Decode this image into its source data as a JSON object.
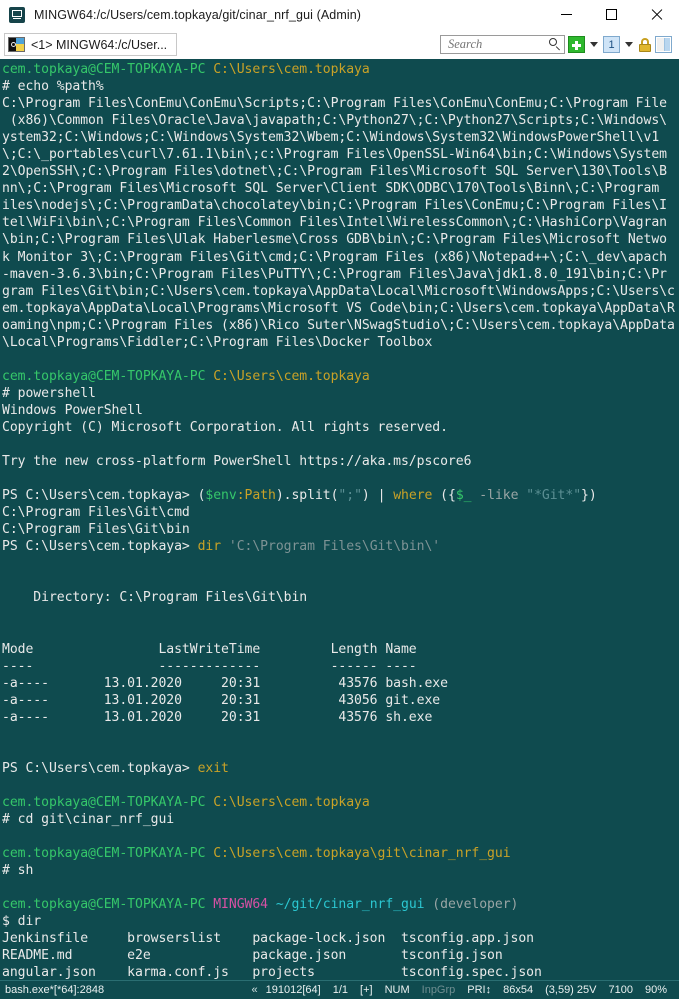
{
  "window": {
    "title": "MINGW64:/c/Users/cem.topkaya/git/cinar_nrf_gui (Admin)",
    "icon": "conemu-icon",
    "minimize_label": "Minimize",
    "maximize_label": "Maximize",
    "close_label": "Close"
  },
  "tabbar": {
    "tabs": [
      {
        "label": "<1> MINGW64:/c/User...",
        "icon": "console-tab-icon"
      }
    ],
    "search": {
      "placeholder": "Search",
      "value": ""
    },
    "buttons": {
      "new_console": "new-console-button",
      "new_console_caret": "new-console-dropdown",
      "active_console": "1",
      "active_console_caret": "console-list-dropdown",
      "lock": "lock-button",
      "panels": "panels-button"
    }
  },
  "terminal": {
    "lines": [
      {
        "id": "l001",
        "segments": [
          {
            "t": "cem.topkaya@CEM-TOPKAYA-PC ",
            "c": "c-green"
          },
          {
            "t": "C:\\Users\\cem.topkaya",
            "c": "c-yellow"
          }
        ]
      },
      {
        "id": "l002",
        "segments": [
          {
            "t": "# echo %path%",
            "c": "c-white"
          }
        ]
      },
      {
        "id": "l003",
        "segments": [
          {
            "t": "C:\\Program Files\\ConEmu\\ConEmu\\Scripts;C:\\Program Files\\ConEmu\\ConEmu;C:\\Program File",
            "c": "c-white"
          }
        ]
      },
      {
        "id": "l004",
        "segments": [
          {
            "t": " (x86)\\Common Files\\Oracle\\Java\\javapath;C:\\Python27\\;C:\\Python27\\Scripts;C:\\Windows\\",
            "c": "c-white"
          }
        ]
      },
      {
        "id": "l005",
        "segments": [
          {
            "t": "ystem32;C:\\Windows;C:\\Windows\\System32\\Wbem;C:\\Windows\\System32\\WindowsPowerShell\\v1",
            "c": "c-white"
          }
        ]
      },
      {
        "id": "l006",
        "segments": [
          {
            "t": "\\;C:\\_portables\\curl\\7.61.1\\bin\\;c:\\Program Files\\OpenSSL-Win64\\bin;C:\\Windows\\System",
            "c": "c-white"
          }
        ]
      },
      {
        "id": "l007",
        "segments": [
          {
            "t": "2\\OpenSSH\\;C:\\Program Files\\dotnet\\;C:\\Program Files\\Microsoft SQL Server\\130\\Tools\\B",
            "c": "c-white"
          }
        ]
      },
      {
        "id": "l008",
        "segments": [
          {
            "t": "nn\\;C:\\Program Files\\Microsoft SQL Server\\Client SDK\\ODBC\\170\\Tools\\Binn\\;C:\\Program ",
            "c": "c-white"
          }
        ]
      },
      {
        "id": "l009",
        "segments": [
          {
            "t": "iles\\nodejs\\;C:\\ProgramData\\chocolatey\\bin;C:\\Program Files\\ConEmu;C:\\Program Files\\I",
            "c": "c-white"
          }
        ]
      },
      {
        "id": "l010",
        "segments": [
          {
            "t": "tel\\WiFi\\bin\\;C:\\Program Files\\Common Files\\Intel\\WirelessCommon\\;C:\\HashiCorp\\Vagran",
            "c": "c-white"
          }
        ]
      },
      {
        "id": "l011",
        "segments": [
          {
            "t": "\\bin;C:\\Program Files\\Ulak Haberlesme\\Cross GDB\\bin\\;C:\\Program Files\\Microsoft Netwo",
            "c": "c-white"
          }
        ]
      },
      {
        "id": "l012",
        "segments": [
          {
            "t": "k Monitor 3\\;C:\\Program Files\\Git\\cmd;C:\\Program Files (x86)\\Notepad++\\;C:\\_dev\\apach",
            "c": "c-white"
          }
        ]
      },
      {
        "id": "l013",
        "segments": [
          {
            "t": "-maven-3.6.3\\bin;C:\\Program Files\\PuTTY\\;C:\\Program Files\\Java\\jdk1.8.0_191\\bin;C:\\Pr",
            "c": "c-white"
          }
        ]
      },
      {
        "id": "l014",
        "segments": [
          {
            "t": "gram Files\\Git\\bin;C:\\Users\\cem.topkaya\\AppData\\Local\\Microsoft\\WindowsApps;C:\\Users\\c",
            "c": "c-white"
          }
        ]
      },
      {
        "id": "l015",
        "segments": [
          {
            "t": "em.topkaya\\AppData\\Local\\Programs\\Microsoft VS Code\\bin;C:\\Users\\cem.topkaya\\AppData\\R",
            "c": "c-white"
          }
        ]
      },
      {
        "id": "l016",
        "segments": [
          {
            "t": "oaming\\npm;C:\\Program Files (x86)\\Rico Suter\\NSwagStudio\\;C:\\Users\\cem.topkaya\\AppData",
            "c": "c-white"
          }
        ]
      },
      {
        "id": "l017",
        "segments": [
          {
            "t": "\\Local\\Programs\\Fiddler;C:\\Program Files\\Docker Toolbox",
            "c": "c-white"
          }
        ]
      },
      {
        "id": "l018",
        "segments": [
          {
            "t": "",
            "c": "c-white"
          }
        ]
      },
      {
        "id": "l019",
        "segments": [
          {
            "t": "cem.topkaya@CEM-TOPKAYA-PC ",
            "c": "c-green"
          },
          {
            "t": "C:\\Users\\cem.topkaya",
            "c": "c-yellow"
          }
        ]
      },
      {
        "id": "l020",
        "segments": [
          {
            "t": "# powershell",
            "c": "c-white"
          }
        ]
      },
      {
        "id": "l021",
        "segments": [
          {
            "t": "Windows PowerShell",
            "c": "c-white"
          }
        ]
      },
      {
        "id": "l022",
        "segments": [
          {
            "t": "Copyright (C) Microsoft Corporation. All rights reserved.",
            "c": "c-white"
          }
        ]
      },
      {
        "id": "l023",
        "segments": [
          {
            "t": "",
            "c": "c-white"
          }
        ]
      },
      {
        "id": "l024",
        "segments": [
          {
            "t": "Try the new cross-platform PowerShell https://aka.ms/pscore6",
            "c": "c-white"
          }
        ]
      },
      {
        "id": "l025",
        "segments": [
          {
            "t": "",
            "c": "c-white"
          }
        ]
      },
      {
        "id": "l026",
        "segments": [
          {
            "t": "PS C:\\Users\\cem.topkaya> ",
            "c": "c-white"
          },
          {
            "t": "(",
            "c": "c-white"
          },
          {
            "t": "$env",
            "c": "c-green"
          },
          {
            "t": ":Path",
            "c": "c-gold"
          },
          {
            "t": ").split(",
            "c": "c-white"
          },
          {
            "t": "\";\"",
            "c": "c-dimcyan"
          },
          {
            "t": ") ",
            "c": "c-white"
          },
          {
            "t": "|",
            "c": "c-white"
          },
          {
            "t": " ",
            "c": "c-white"
          },
          {
            "t": "where",
            "c": "c-gold"
          },
          {
            "t": " ({",
            "c": "c-white"
          },
          {
            "t": "$_",
            "c": "c-green"
          },
          {
            "t": " -like ",
            "c": "c-grey"
          },
          {
            "t": "\"*Git*\"",
            "c": "c-dimcyan"
          },
          {
            "t": "})",
            "c": "c-white"
          }
        ]
      },
      {
        "id": "l027",
        "segments": [
          {
            "t": "C:\\Program Files\\Git\\cmd",
            "c": "c-white"
          }
        ]
      },
      {
        "id": "l028",
        "segments": [
          {
            "t": "C:\\Program Files\\Git\\bin",
            "c": "c-white"
          }
        ]
      },
      {
        "id": "l029",
        "segments": [
          {
            "t": "PS C:\\Users\\cem.topkaya> ",
            "c": "c-white"
          },
          {
            "t": "dir",
            "c": "c-gold"
          },
          {
            "t": " ",
            "c": "c-white"
          },
          {
            "t": "'C:\\Program Files\\Git\\bin\\'",
            "c": "c-dkgrey"
          }
        ]
      },
      {
        "id": "l030",
        "segments": [
          {
            "t": "",
            "c": "c-white"
          }
        ]
      },
      {
        "id": "l031",
        "segments": [
          {
            "t": "",
            "c": "c-white"
          }
        ]
      },
      {
        "id": "l032",
        "segments": [
          {
            "t": "    Directory: C:\\Program Files\\Git\\bin",
            "c": "c-white"
          }
        ]
      },
      {
        "id": "l033",
        "segments": [
          {
            "t": "",
            "c": "c-white"
          }
        ]
      },
      {
        "id": "l034",
        "segments": [
          {
            "t": "",
            "c": "c-white"
          }
        ]
      },
      {
        "id": "l035",
        "segments": [
          {
            "t": "Mode                LastWriteTime         Length Name",
            "c": "c-white"
          }
        ]
      },
      {
        "id": "l036",
        "segments": [
          {
            "t": "----                -------------         ------ ----",
            "c": "c-white"
          }
        ]
      },
      {
        "id": "l037",
        "segments": [
          {
            "t": "-a----       13.01.2020     20:31          43576 bash.exe",
            "c": "c-white"
          }
        ]
      },
      {
        "id": "l038",
        "segments": [
          {
            "t": "-a----       13.01.2020     20:31          43056 git.exe",
            "c": "c-white"
          }
        ]
      },
      {
        "id": "l039",
        "segments": [
          {
            "t": "-a----       13.01.2020     20:31          43576 sh.exe",
            "c": "c-white"
          }
        ]
      },
      {
        "id": "l040",
        "segments": [
          {
            "t": "",
            "c": "c-white"
          }
        ]
      },
      {
        "id": "l041",
        "segments": [
          {
            "t": "",
            "c": "c-white"
          }
        ]
      },
      {
        "id": "l042",
        "segments": [
          {
            "t": "PS C:\\Users\\cem.topkaya> ",
            "c": "c-white"
          },
          {
            "t": "exit",
            "c": "c-gold"
          }
        ]
      },
      {
        "id": "l043",
        "segments": [
          {
            "t": "",
            "c": "c-white"
          }
        ]
      },
      {
        "id": "l044",
        "segments": [
          {
            "t": "cem.topkaya@CEM-TOPKAYA-PC ",
            "c": "c-green"
          },
          {
            "t": "C:\\Users\\cem.topkaya",
            "c": "c-yellow"
          }
        ]
      },
      {
        "id": "l045",
        "segments": [
          {
            "t": "# cd git\\cinar_nrf_gui",
            "c": "c-white"
          }
        ]
      },
      {
        "id": "l046",
        "segments": [
          {
            "t": "",
            "c": "c-white"
          }
        ]
      },
      {
        "id": "l047",
        "segments": [
          {
            "t": "cem.topkaya@CEM-TOPKAYA-PC ",
            "c": "c-green"
          },
          {
            "t": "C:\\Users\\cem.topkaya\\git\\cinar_nrf_gui",
            "c": "c-yellow"
          }
        ]
      },
      {
        "id": "l048",
        "segments": [
          {
            "t": "# sh",
            "c": "c-white"
          }
        ]
      },
      {
        "id": "l049",
        "segments": [
          {
            "t": "",
            "c": "c-white"
          }
        ]
      },
      {
        "id": "l050",
        "segments": [
          {
            "t": "cem.topkaya@CEM-TOPKAYA-PC ",
            "c": "c-green"
          },
          {
            "t": "MINGW64 ",
            "c": "c-magenta"
          },
          {
            "t": "~/git/cinar_nrf_gui",
            "c": "c-cyan"
          },
          {
            "t": " (developer)",
            "c": "c-grey"
          }
        ]
      },
      {
        "id": "l051",
        "segments": [
          {
            "t": "$ dir",
            "c": "c-white"
          }
        ]
      },
      {
        "id": "l052",
        "segments": [
          {
            "t": "Jenkinsfile     browserslist    package-lock.json  tsconfig.app.json",
            "c": "c-white"
          }
        ]
      },
      {
        "id": "l053",
        "segments": [
          {
            "t": "README.md       e2e             package.json       tsconfig.json",
            "c": "c-white"
          }
        ]
      },
      {
        "id": "l054",
        "segments": [
          {
            "t": "angular.json    karma.conf.js   projects           tsconfig.spec.json",
            "c": "c-white"
          }
        ]
      }
    ]
  },
  "statusbar": {
    "process": "bash.exe*[*64]:2848",
    "chevron": "«",
    "build": "191012[64]",
    "tabs": "1/1",
    "admin": "[+]",
    "num": "NUM",
    "inpgrp": "InpGrp",
    "pri": "PRI↕",
    "size": "86x54",
    "cursor": "(3,59) 25V",
    "buffer": "7100",
    "zoom": "90%"
  }
}
